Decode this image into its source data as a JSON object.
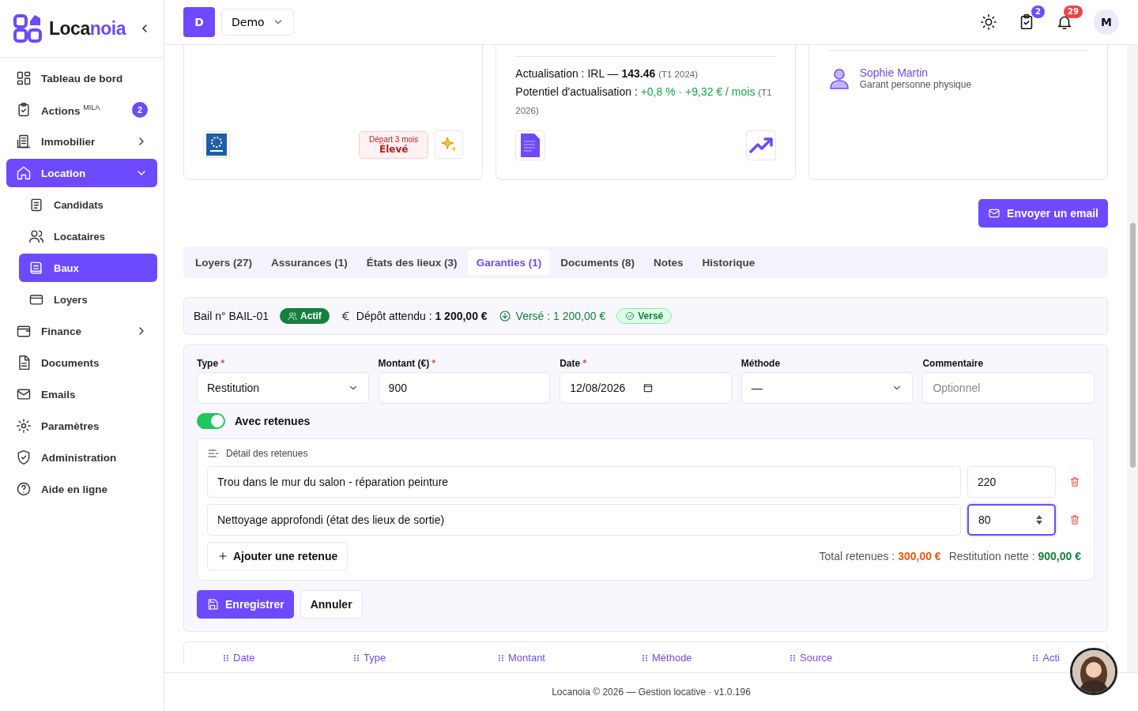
{
  "header": {
    "org_initial": "D",
    "org_name": "Demo",
    "tasks_badge": "2",
    "notifications_badge": "29",
    "user_initial": "M"
  },
  "sidebar": {
    "brand_first": "Loca",
    "brand_second": "noia",
    "items": [
      {
        "kind": "link",
        "label": "Tableau de bord",
        "selected": false
      },
      {
        "kind": "link",
        "label": "Actions $^{MILA}$",
        "badge": "2",
        "selected": false
      },
      {
        "kind": "group",
        "label": "Immobilier",
        "expanded": false,
        "selected": false
      },
      {
        "kind": "group",
        "label": "Location",
        "expanded": true,
        "selected": true,
        "children": [
          {
            "label": "Candidats",
            "selected": false
          },
          {
            "label": "Locataires",
            "selected": false
          },
          {
            "label": "Baux",
            "selected": true
          },
          {
            "label": "Loyers",
            "selected": false
          }
        ]
      },
      {
        "kind": "group",
        "label": "Finance",
        "expanded": false,
        "selected": false
      },
      {
        "kind": "link",
        "label": "Documents",
        "selected": false
      },
      {
        "kind": "link",
        "label": "Emails",
        "selected": false
      },
      {
        "kind": "link",
        "label": "Paramètres",
        "selected": false
      },
      {
        "kind": "link",
        "label": "Administration",
        "selected": false
      },
      {
        "kind": "link",
        "label": "Aide en ligne",
        "selected": false
      }
    ]
  },
  "tenant_card": {
    "risk_label": "Départ 3 mois",
    "risk_value": "Élevé"
  },
  "rent_card": {
    "indexation": "Actualisation : IRL — **143.46**",
    "indexation_period": "(T1 2024)",
    "potential_label": "Potentiel d'actualisation :",
    "potential_value": "+0,8 % · +9,32 € / mois",
    "potential_period": "(T1 2026)"
  },
  "guarantor_card": {
    "name": "Sophie Martin",
    "role": "Garant personne physique"
  },
  "email_button": "Envoyer un email",
  "tabs": [
    {
      "label": "Loyers (27)",
      "selected": false
    },
    {
      "label": "Assurances (1)",
      "selected": false
    },
    {
      "label": "États des lieux (3)",
      "selected": false
    },
    {
      "label": "Garanties (1)",
      "selected": true
    },
    {
      "label": "Documents (8)",
      "selected": false
    },
    {
      "label": "Notes",
      "selected": false
    },
    {
      "label": "Historique",
      "selected": false
    }
  ],
  "lease_bar": {
    "lease": "Bail n° BAIL-01",
    "status": "Actif",
    "deposit_label": "Dépôt attendu :",
    "deposit_value": "1 200,00 €",
    "paid": "Versé : 1 200,00 €",
    "paid_badge": "Versé"
  },
  "form": {
    "required_mark": "*",
    "fields": [
      {
        "kind": "select",
        "label": "Type",
        "required": true,
        "value": "Restitution"
      },
      {
        "kind": "text",
        "label": "Montant (€)",
        "required": true,
        "value": "900"
      },
      {
        "kind": "date",
        "label": "Date",
        "required": true,
        "value": "12/08/2026"
      },
      {
        "kind": "select",
        "label": "Méthode",
        "required": false,
        "value": "—"
      },
      {
        "kind": "text",
        "label": "Commentaire",
        "required": false,
        "placeholder": "Optionnel"
      }
    ],
    "toggle": {
      "label": "Avec retenues",
      "on": true
    },
    "deductions": {
      "title": "Détail des retenues",
      "rows": [
        {
          "description": "Trou dans le mur du salon - réparation peinture",
          "amount": "220",
          "focused": false
        },
        {
          "description": "Nettoyage approfondi (état des lieux de sortie)",
          "amount": "80",
          "focused": true
        }
      ],
      "add_button": "Ajouter une retenue",
      "total_label": "Total retenues :",
      "total_value": "300,00 €",
      "net_label": "Restitution nette :",
      "net_value": "900,00 €"
    },
    "save_button": "Enregistrer",
    "cancel_button": "Annuler"
  },
  "table": {
    "columns": [
      "Date",
      "Type",
      "Montant",
      "Méthode",
      "Source",
      "Acti"
    ]
  },
  "footer": "Locanoia © 2026 — Gestion locative · v1.0.196"
}
